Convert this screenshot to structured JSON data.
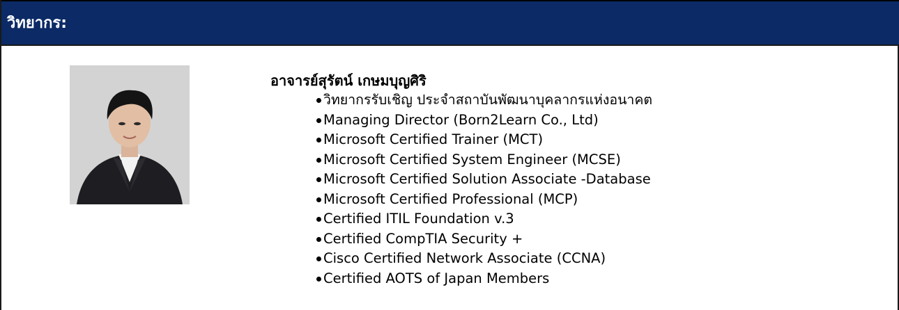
{
  "header": {
    "title": "วิทยากร:"
  },
  "speaker": {
    "photo_alt": "speaker-portrait",
    "name": "อาจารย์สุรัตน์ เกษมบุญศิริ",
    "qualifications": [
      "วิทยากรรับเชิญ ประจำสถาบันพัฒนาบุคลากรแห่งอนาคต",
      "Managing Director (Born2Learn Co., Ltd)",
      "Microsoft Certified Trainer (MCT)",
      "Microsoft Certified System Engineer (MCSE)",
      "Microsoft Certified Solution Associate -Database",
      "Microsoft Certified Professional (MCP)",
      "Certified ITIL Foundation v.3",
      "Certified CompTIA Security +",
      "Cisco Certified Network Associate (CCNA)",
      "Certified AOTS of Japan Members"
    ]
  },
  "colors": {
    "header_bg": "#0b2a66",
    "header_text": "#ffffff",
    "body_text": "#000000"
  }
}
